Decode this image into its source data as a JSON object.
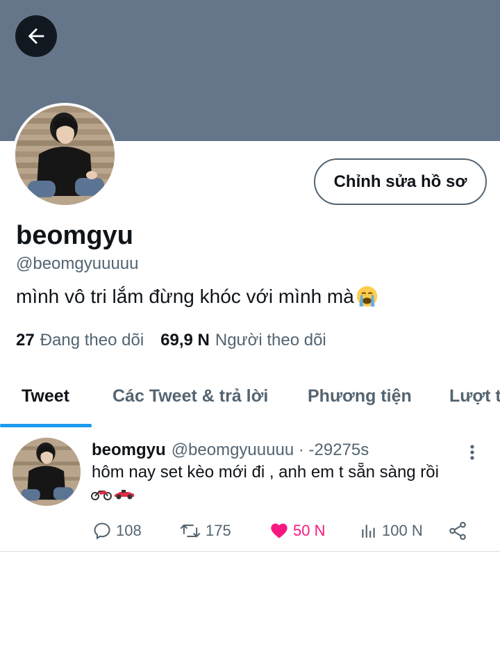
{
  "header": {
    "back_icon": "arrow-left-icon",
    "banner_color": "#66768a"
  },
  "profile": {
    "avatar": "profile-photo",
    "edit_label": "Chỉnh sửa hồ sơ",
    "display_name": "beomgyu",
    "handle": "@beomgyuuuuu",
    "bio_text": "mình vô tri lắm đừng khóc với mình mà",
    "bio_emoji": "loudly-crying-face-icon",
    "following_count": "27",
    "following_label": "Đang theo dõi",
    "followers_count": "69,9 N",
    "followers_label": "Người theo dõi"
  },
  "tabs": [
    {
      "label": "Tweet",
      "active": true
    },
    {
      "label": "Các Tweet & trả lời",
      "active": false
    },
    {
      "label": "Phương tiện",
      "active": false
    },
    {
      "label": "Lượt thích",
      "active": false
    }
  ],
  "tweet": {
    "name": "beomgyu",
    "handle_time": "@beomgyuuuuu · -29275s",
    "text": "hôm nay set kèo mới đi , anh em t sẵn sàng rồi",
    "emojis": [
      "motorcycle-icon",
      "racing-car-icon"
    ],
    "replies": "108",
    "retweets": "175",
    "likes": "50 N",
    "views": "100 N"
  },
  "colors": {
    "accent": "#1d9bf0",
    "like": "#f91880",
    "secondary_text": "#536471"
  }
}
